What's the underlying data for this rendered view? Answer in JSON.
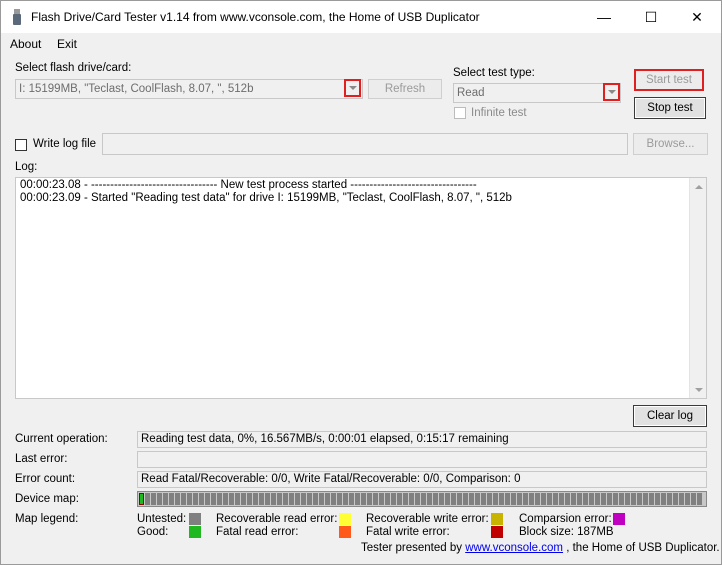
{
  "window": {
    "title": "Flash Drive/Card Tester v1.14 from www.vconsole.com, the Home of USB Duplicator",
    "minimize": "—",
    "maximize": "☐",
    "close": "✕"
  },
  "menu": {
    "about": "About",
    "exit": "Exit"
  },
  "drive": {
    "label": "Select flash drive/card:",
    "value": "I: 15199MB, \"Teclast, CoolFlash, 8.07, \", 512b",
    "refresh": "Refresh"
  },
  "test_type": {
    "label": "Select test type:",
    "value": "Read",
    "infinite_label": "Infinite test"
  },
  "buttons": {
    "start": "Start test",
    "stop": "Stop test",
    "browse": "Browse...",
    "clear_log": "Clear log"
  },
  "write_log": {
    "label": "Write log file",
    "path": ""
  },
  "log": {
    "label": "Log:",
    "lines": [
      "00:00:23.08 - --------------------------------- New test process started ---------------------------------",
      "00:00:23.09 - Started \"Reading test data\" for drive I: 15199MB, \"Teclast, CoolFlash, 8.07, \", 512b"
    ]
  },
  "status": {
    "current_operation_label": "Current operation:",
    "current_operation": "Reading test data, 0%, 16.567MB/s, 0:00:01 elapsed, 0:15:17 remaining",
    "last_error_label": "Last error:",
    "last_error": "",
    "error_count_label": "Error count:",
    "error_count": "Read Fatal/Recoverable: 0/0, Write Fatal/Recoverable: 0/0, Comparison: 0",
    "device_map_label": "Device map:",
    "map_legend_label": "Map legend:"
  },
  "legend": {
    "untested": {
      "label": "Untested:",
      "color": "#808080"
    },
    "good": {
      "label": "Good:",
      "color": "#1fb820"
    },
    "recoverable_read": {
      "label": "Recoverable read error:",
      "color": "#ffff33"
    },
    "fatal_read": {
      "label": "Fatal read error:",
      "color": "#ff5a1a"
    },
    "recoverable_write": {
      "label": "Recoverable write error:",
      "color": "#c8b400"
    },
    "fatal_write": {
      "label": "Fatal write error:",
      "color": "#c00000"
    },
    "comparison": {
      "label": "Comparsion error:",
      "color": "#c000c0"
    },
    "block_size": "Block size: 187MB"
  },
  "footer": {
    "prefix": "Tester presented by",
    "link": "www.vconsole.com",
    "suffix": ", the Home of USB Duplicator."
  },
  "device_map": {
    "good_blocks": 1
  }
}
